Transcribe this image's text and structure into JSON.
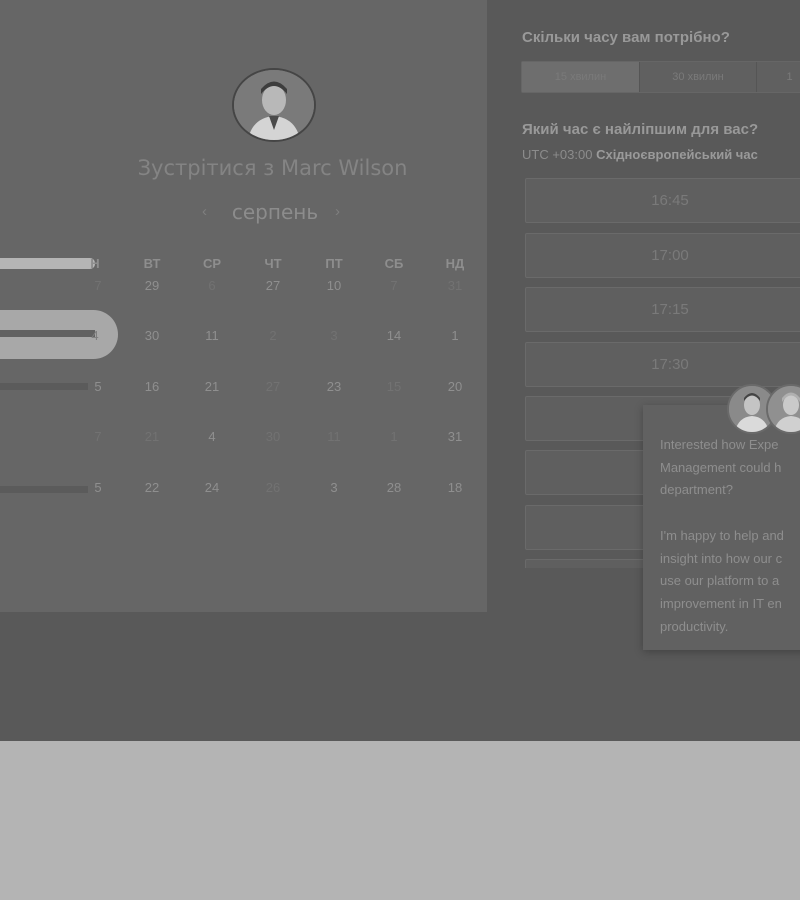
{
  "host": {
    "meet_title": "Зустрітися з Marc Wilson",
    "avatar_icon": "host-avatar-photo"
  },
  "calendar": {
    "prev_icon": "‹",
    "next_icon": "›",
    "month": "серпень",
    "weekdays": [
      "Н",
      "ВТ",
      "СР",
      "ЧТ",
      "ПТ",
      "СБ",
      "НД"
    ],
    "weeks": [
      [
        "7",
        "29",
        "6",
        "27",
        "10",
        "7",
        "31"
      ],
      [
        "4",
        "30",
        "11",
        "2",
        "3",
        "14",
        "1"
      ],
      [
        "5",
        "16",
        "21",
        "27",
        "23",
        "15",
        "20"
      ],
      [
        "7",
        "21",
        "4",
        "30",
        "11",
        "1",
        "31"
      ],
      [
        "5",
        "22",
        "24",
        "26",
        "3",
        "28",
        "18"
      ]
    ]
  },
  "duration": {
    "question": "Скільки часу вам потрібно?",
    "options": [
      "15 хвилин",
      "30 хвилин",
      "1"
    ],
    "selected_index": 0
  },
  "time": {
    "question": "Який час є найліпшим для вас?",
    "tz_offset": "UTC +03:00",
    "tz_name": "Східноєвропейський час",
    "slots": [
      "16:45",
      "17:00",
      "17:15",
      "17:30",
      "",
      "",
      "",
      ""
    ]
  },
  "chat": {
    "message": "Interested how Expe\nManagement could h\ndepartment?\n\nI'm happy to help and\ninsight into how our c\nuse our platform to a\nimprovement in IT en\nproductivity.",
    "avatar_icons": [
      "agent-avatar-1",
      "agent-avatar-2"
    ]
  },
  "colors": {
    "overlay_page": "#595959",
    "left_panel": "#666666",
    "below": "#b4b4b4"
  }
}
